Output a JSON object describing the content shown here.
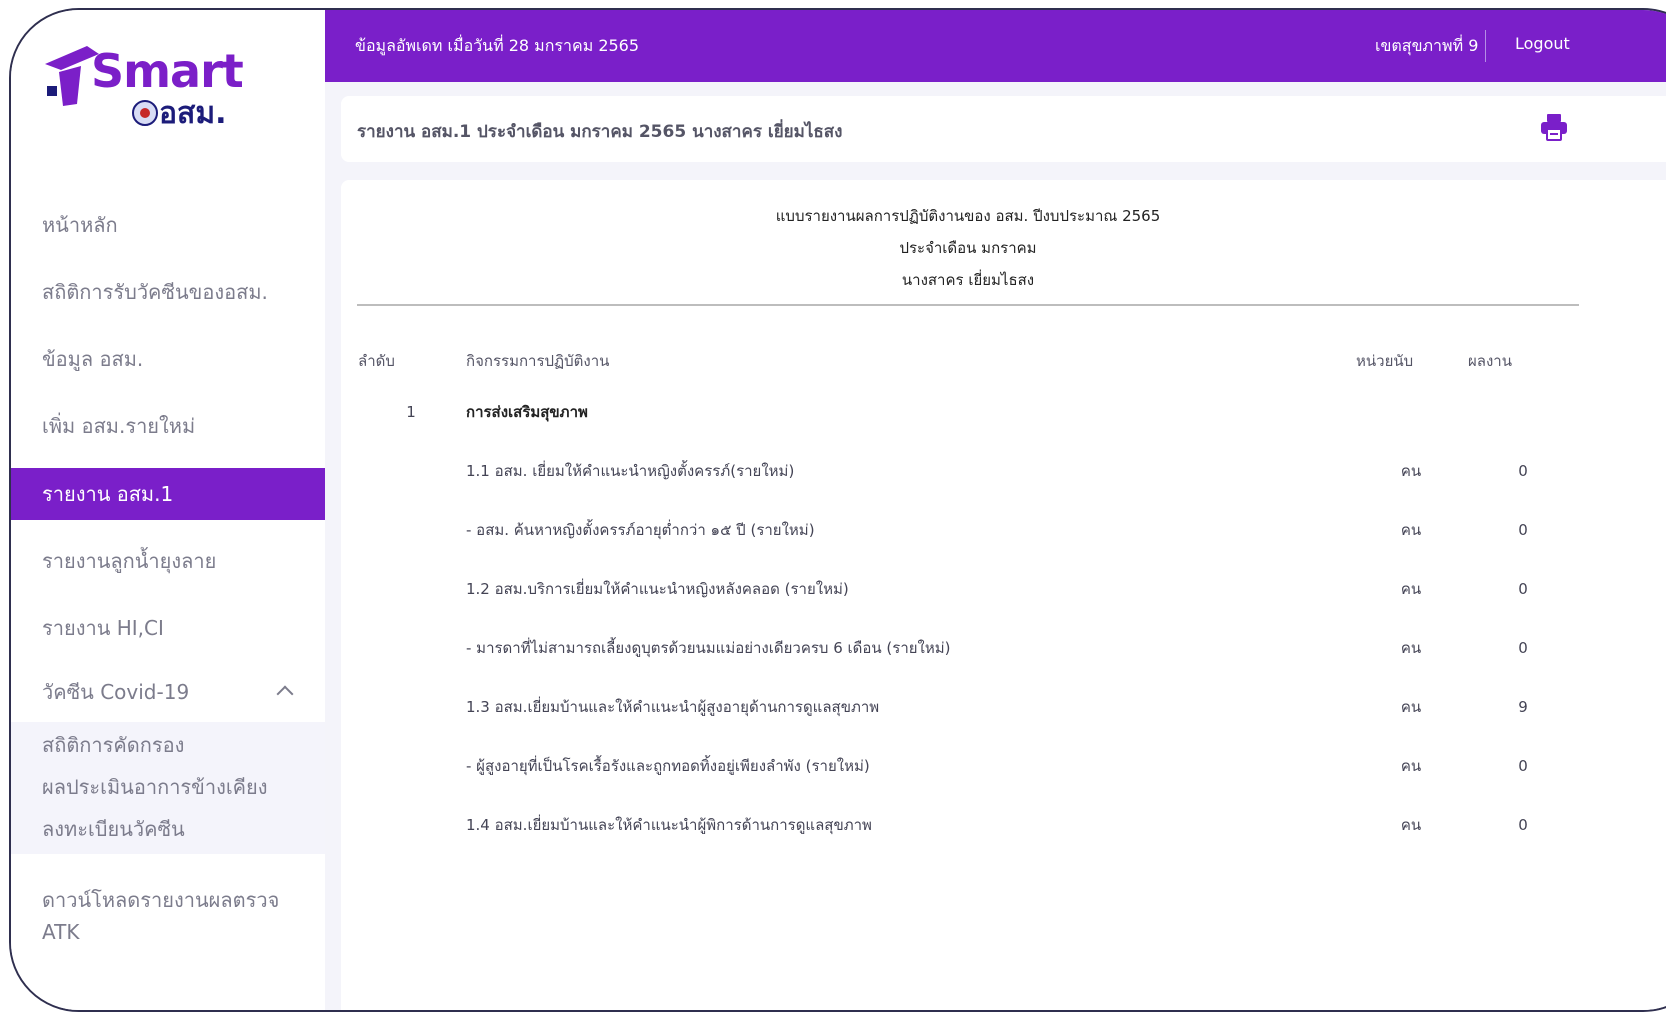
{
  "header": {
    "update_text": "ข้อมูลอัพเดท เมื่อวันที่ 28 มกราคม 2565",
    "region": "เขตสุขภาพที่ 9",
    "logout": "Logout"
  },
  "logo": {
    "word": "Smart",
    "sub": "อสม."
  },
  "sidebar": {
    "items": [
      {
        "label": "หน้าหลัก"
      },
      {
        "label": "สถิติการรับวัคซีนของอสม."
      },
      {
        "label": "ข้อมูล อสม."
      },
      {
        "label": "เพิ่ม อสม.รายใหม่"
      },
      {
        "label": "รายงาน อสม.1"
      },
      {
        "label": "รายงานลูกน้ำยุงลาย"
      },
      {
        "label": "รายงาน HI,CI"
      }
    ],
    "group": {
      "label": "วัคซีน Covid-19",
      "subitems": [
        {
          "label": "สถิติการคัดกรอง"
        },
        {
          "label": "ผลประเมินอาการข้างเคียง"
        },
        {
          "label": "ลงทะเบียนวัคซีน"
        }
      ]
    },
    "download": "ดาวน์โหลดรายงานผลตรวจ ATK"
  },
  "title": "รายงาน อสม.1 ประจำเดือน มกราคม 2565 นางสาคร เยี่ยมไธสง",
  "report": {
    "heading": "แบบรายงานผลการปฏิบัติงานของ อสม. ปีงบประมาณ 2565",
    "month": "ประจำเดือน มกราคม",
    "name": "นางสาคร เยี่ยมไธสง",
    "columns": {
      "no": "ลำดับ",
      "activity": "กิจกรรมการปฏิบัติงาน",
      "unit": "หน่วยนับ",
      "result": "ผลงาน"
    },
    "section": {
      "no": "1",
      "title": "การส่งเสริมสุขภาพ"
    },
    "rows": [
      {
        "activity": "1.1 อสม. เยี่ยมให้คำแนะนำหญิงตั้งครรภ์(รายใหม่)",
        "unit": "คน",
        "result": "0"
      },
      {
        "activity": "- อสม. ค้นหาหญิงตั้งครรภ์อายุต่ำกว่า ๑๕ ปี (รายใหม่)",
        "unit": "คน",
        "result": "0"
      },
      {
        "activity": "1.2 อสม.บริการเยี่ยมให้คำแนะนำหญิงหลังคลอด (รายใหม่)",
        "unit": "คน",
        "result": "0"
      },
      {
        "activity": "- มารดาที่ไม่สามารถเลี้ยงดูบุตรด้วยนมแม่อย่างเดียวครบ 6 เดือน (รายใหม่)",
        "unit": "คน",
        "result": "0"
      },
      {
        "activity": "1.3 อสม.เยี่ยมบ้านและให้คำแนะนำผู้สูงอายุด้านการดูแลสุขภาพ",
        "unit": "คน",
        "result": "9"
      },
      {
        "activity": "- ผู้สูงอายุที่เป็นโรคเรื้อรังและถูกทอดทิ้งอยู่เพียงลำพัง (รายใหม่)",
        "unit": "คน",
        "result": "0"
      },
      {
        "activity": "1.4 อสม.เยี่ยมบ้านและให้คำแนะนำผู้พิการด้านการดูแลสุขภาพ",
        "unit": "คน",
        "result": "0"
      }
    ]
  },
  "icons": {
    "print": "printer-icon",
    "chevron": "chevron-up-icon"
  },
  "colors": {
    "brand": "#7a1fc9",
    "navy": "#1c1c7a"
  }
}
